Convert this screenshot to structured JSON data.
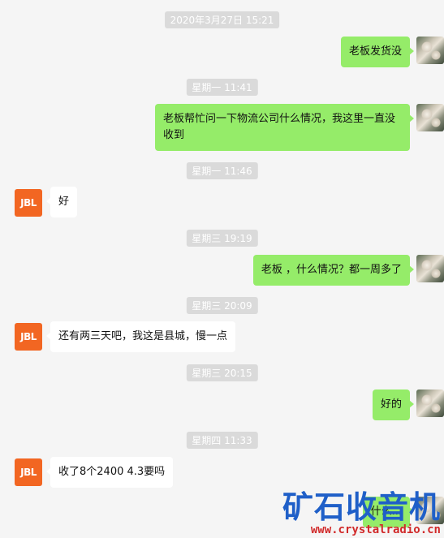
{
  "messages": [
    {
      "type": "time",
      "text": "2020年3月27日 15:21"
    },
    {
      "type": "out",
      "text": "老板发货没"
    },
    {
      "type": "time",
      "text": "星期一 11:41"
    },
    {
      "type": "out",
      "text": "老板帮忙问一下物流公司什么情况，我这里一直没收到"
    },
    {
      "type": "time",
      "text": "星期一 11:46"
    },
    {
      "type": "in",
      "text": "好"
    },
    {
      "type": "time",
      "text": "星期三 19:19"
    },
    {
      "type": "out",
      "text": "老板 ，什么情况？都一周多了"
    },
    {
      "type": "time",
      "text": "星期三 20:09"
    },
    {
      "type": "in",
      "text": "还有两三天吧，我这是县城，慢一点"
    },
    {
      "type": "time",
      "text": "星期三 20:15"
    },
    {
      "type": "out",
      "text": "好的"
    },
    {
      "type": "time",
      "text": "星期四 11:33"
    },
    {
      "type": "in",
      "text": "收了8个2400 4.3要吗"
    },
    {
      "type": "out",
      "text": "什么..."
    }
  ],
  "contact": {
    "avatar_text": "JBL",
    "avatar_color": "#f26622"
  },
  "watermark": {
    "title": "矿石收音机",
    "url": "www.crystalradio.cn"
  }
}
